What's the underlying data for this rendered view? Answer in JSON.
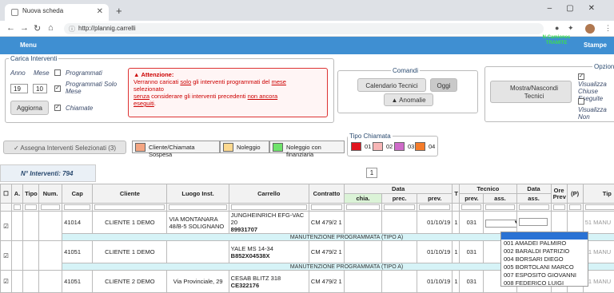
{
  "browser": {
    "tab_title": "Nuova scheda",
    "url": "http://plannig.carrelli"
  },
  "nav": {
    "menu": "Menu",
    "stampe": "Stampe",
    "ncam": "N.Camiones TRAMITE"
  },
  "carica": {
    "legend": "Carica Interventi",
    "anno_label": "Anno",
    "mese_label": "Mese",
    "anno_value": "19",
    "mese_value": "10",
    "programmati_label": "Programmati",
    "prog_solo_mese_label": "Programmati Solo Mese",
    "chiamate_label": "Chiamate",
    "aggiorna": "Aggiorna"
  },
  "warning": {
    "title": "Attenzione:",
    "l1a": "Verranno caricati ",
    "l1b": "solo",
    "l1c": " gli interventi programmati del ",
    "l1d": "mese",
    "l2": "selezionato",
    "l3a": "senza",
    "l3b": " considerare gli interventi precedenti ",
    "l3c": "non ancora",
    "l4": "eseguiti",
    "l4b": "."
  },
  "comandi": {
    "legend": "Comandi",
    "calendario": "Calendario Tecnici",
    "oggi": "Oggi",
    "anomalie": "Anomalie"
  },
  "opzioni": {
    "legend": "Opzioni",
    "mostra": "Mostra/Nascondi Tecnici",
    "vis_chiuse": "Visualizza Chiuse Eseguite",
    "vis_non": "Visualizza Non"
  },
  "assegna": "Assegna Interventi Selezionati (3)",
  "legend_items": [
    {
      "label": "Cliente/Chiamata Sospesa",
      "color": "#f4a582"
    },
    {
      "label": "Noleggio",
      "color": "#fdd98f"
    },
    {
      "label": "Noleggio con finanziaria",
      "color": "#6fe36b"
    }
  ],
  "tipo": {
    "legend": "Tipo Chiamata",
    "items": [
      {
        "label": "01",
        "color": "#e0141e"
      },
      {
        "label": "02",
        "color": "#f7b6b6"
      },
      {
        "label": "03",
        "color": "#cf6bc9"
      },
      {
        "label": "04",
        "color": "#f57c2a"
      }
    ]
  },
  "count": "N° Interventi: 794",
  "page": "1",
  "headers": {
    "a": "A.",
    "tipo": "Tipo",
    "num": "Num.",
    "cap": "Cap",
    "cliente": "Cliente",
    "luogo": "Luogo Inst.",
    "carrello": "Carrello",
    "contratto": "Contratto",
    "data": "Data",
    "chia": "chia.",
    "prec": "prec.",
    "prev": "prev.",
    "t": "T",
    "tecnico": "Tecnico",
    "tprev": "prev.",
    "tass": "ass.",
    "data2": "Data",
    "dass": "ass.",
    "ore": "Ore Prev",
    "p": "(P)",
    "tip": "Tip"
  },
  "rows": [
    {
      "cap": "41014",
      "cliente": "CLIENTE 1 DEMO",
      "luogo": "VIA MONTANARA 48/B-5 SOLIGNANO",
      "carrello1": "JUNGHEINRICH EFG-VAC 20",
      "carrello2": "89931707",
      "contratto": "CM 479/2",
      "n": "1",
      "prev": "01/10/19",
      "t": "1",
      "tprev": "031",
      "tip": "51 MANU",
      "sub": "MANUTENZIONE PROGRAMMATA (TIPO A)"
    },
    {
      "cap": "41051",
      "cliente": "CLIENTE 1 DEMO",
      "luogo": "",
      "carrello1": "YALE MS 14-34",
      "carrello2": "B852X04538X",
      "contratto": "CM 479/2",
      "n": "1",
      "prev": "01/10/19",
      "t": "1",
      "tprev": "031",
      "tip": "51 MANU",
      "sub": "MANUTENZIONE PROGRAMMATA (TIPO A)"
    },
    {
      "cap": "41051",
      "cliente": "CLIENTE 2 DEMO",
      "luogo": "Via Provinciale, 29",
      "carrello1": "CESAB BLITZ 318",
      "carrello2": "CE322176",
      "contratto": "CM 479/2",
      "n": "1",
      "prev": "01/10/19",
      "t": "1",
      "tprev": "031",
      "tip": "51 MANU",
      "sub": ""
    }
  ],
  "dropdown": [
    "001 AMADEI PALMIRO",
    "002 BARALDI PATRIZIO",
    "004 BORSARI DIEGO",
    "005 BORTOLANI MARCO",
    "007 ESPOSITO GIOVANNI",
    "008 FEDERICO LUIGI"
  ]
}
